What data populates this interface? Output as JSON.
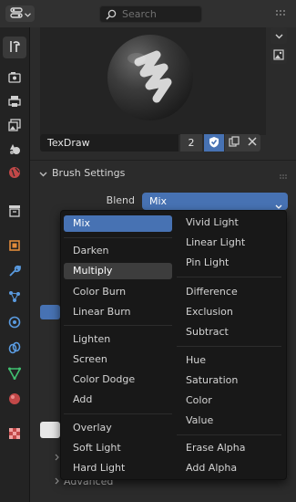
{
  "header": {
    "search_placeholder": "Search"
  },
  "sidebar": {
    "tabs": [
      "tool",
      "render",
      "output",
      "view-layer",
      "scene",
      "world",
      "collection",
      "object",
      "modifiers",
      "particles",
      "physics",
      "constraints",
      "data",
      "material",
      "texture"
    ],
    "active_tab": "tool"
  },
  "brush": {
    "name": "TexDraw",
    "users": "2"
  },
  "brush_settings": {
    "title": "Brush Settings",
    "blend_label": "Blend",
    "blend_value": "Mix"
  },
  "behind_menu": {
    "advanced_label": "Advanced"
  },
  "blend_menu": {
    "col1": [
      {
        "label": "Mix",
        "state": "selected"
      },
      {
        "label": "Darken"
      },
      {
        "label": "Multiply",
        "state": "hover"
      },
      {
        "label": "Color Burn"
      },
      {
        "label": "Linear Burn"
      },
      {
        "label": "Lighten"
      },
      {
        "label": "Screen"
      },
      {
        "label": "Color Dodge"
      },
      {
        "label": "Add"
      },
      {
        "label": "Overlay"
      },
      {
        "label": "Soft Light"
      },
      {
        "label": "Hard Light"
      }
    ],
    "col2": [
      {
        "label": "Vivid Light"
      },
      {
        "label": "Linear Light"
      },
      {
        "label": "Pin Light"
      },
      {
        "label": "Difference"
      },
      {
        "label": "Exclusion"
      },
      {
        "label": "Subtract"
      },
      {
        "label": "Hue"
      },
      {
        "label": "Saturation"
      },
      {
        "label": "Color"
      },
      {
        "label": "Value"
      },
      {
        "label": "Erase Alpha"
      },
      {
        "label": "Add Alpha"
      }
    ]
  },
  "colors": {
    "accent": "#4772b3",
    "panel": "#2b2b2b",
    "menu": "#181818"
  }
}
